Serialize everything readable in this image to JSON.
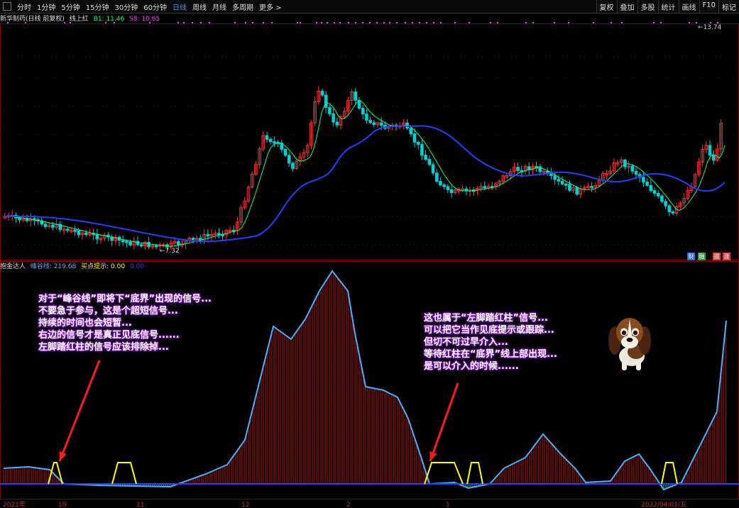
{
  "toolbar": {
    "periods": [
      "分时",
      "1分钟",
      "5分钟",
      "15分钟",
      "30分钟",
      "60分钟",
      "日线",
      "周线",
      "月线",
      "多周期",
      "更多 >"
    ],
    "active": "日线",
    "right_buttons": [
      "复权",
      "叠加",
      "多股",
      "统计",
      "画线",
      "F10",
      "标记"
    ]
  },
  "main_info": {
    "title": "新华制药(日线 前复权)",
    "indicator": "线上红",
    "b1": "B1: 11.46",
    "s8": "S8: 10.65",
    "high_label": "13.74",
    "low_label": "7.32"
  },
  "sub_info": {
    "indicator": "抱金达人",
    "feng_gu": "峰谷线: 219.68",
    "buy_hint": "买点提示: 0.00",
    "extra": "0.00"
  },
  "fin_marks": [
    {
      "label": "财",
      "color": "#2a6fd6"
    },
    {
      "label": "融",
      "color": "#2aa040"
    },
    {
      "label": "描",
      "color": "#d04040"
    },
    {
      "label": "涨",
      "color": "#d04040"
    }
  ],
  "date_labels": [
    "2021年",
    "10",
    "11",
    "12",
    "1",
    "2",
    "2022/04/01/五"
  ],
  "colors": {
    "accent": "#3c8cff",
    "up": "#ff3030",
    "down": "#00d0d0",
    "ma_fast": "#00ff80",
    "ma_slow": "#2040ff",
    "peak": "#4ab0ff",
    "signal": "#ffff00"
  },
  "notes": {
    "left": [
      "对于“峰谷线”即将下“底界”出现的信号...",
      "不要急于参与，这是个超短信号...",
      "持续的时间也会短暂...",
      "右边的信号才是真正见底信号......",
      "左脚踏红柱的信号应该排除掉..."
    ],
    "right": [
      "这也属于“左脚踏红柱”信号...",
      "可以把它当作见底提示或跟踪...",
      "但切不可过早介入...",
      "等待红柱在“底界”线上部出现...",
      "是可以介入的时候......"
    ]
  }
}
